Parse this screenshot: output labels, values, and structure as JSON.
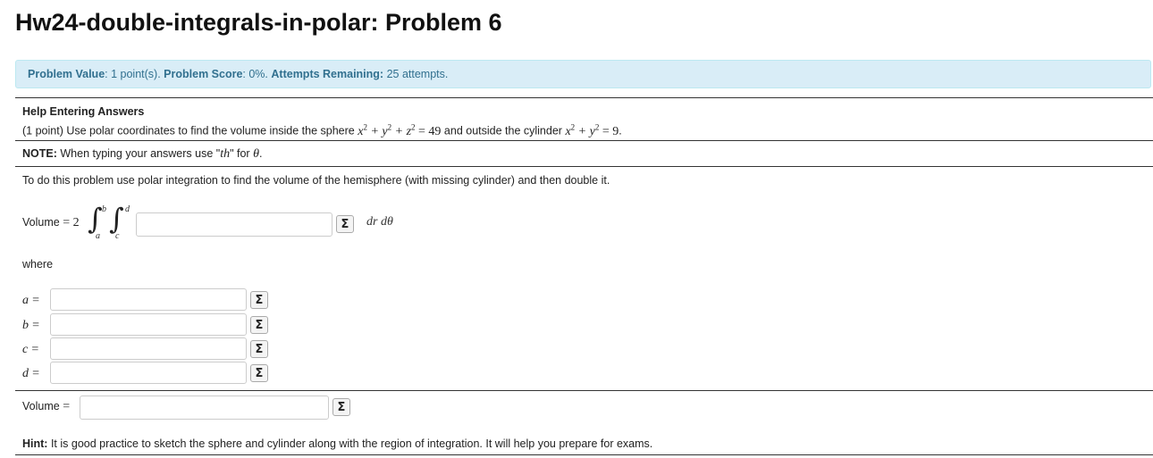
{
  "header": {
    "title": "Hw24-double-integrals-in-polar: Problem 6"
  },
  "info_bar": {
    "value_label": "Problem Value",
    "value_text": ": 1 point(s).",
    "score_label": "Problem Score",
    "score_text": ": 0%.",
    "attempts_label": "Attempts Remaining:",
    "attempts_text": "25 attempts."
  },
  "problem": {
    "help_link": "Help Entering Answers",
    "statement_prefix": "(1 point) Use polar coordinates to find the volume inside the sphere",
    "sphere_eq": "x² + y² + z² = 49",
    "statement_mid": "and outside the cylinder",
    "cylinder_eq": "x² + y² = 9",
    "statement_end": ".",
    "note_label": "NOTE:",
    "note_text": "When typing your answers use \"",
    "note_th": "th",
    "note_mid": "\" for",
    "note_theta": "θ",
    "note_end": ".",
    "instruction": "To do this problem use polar integration to find the volume of the hemisphere (with missing cylinder) and then double it.",
    "volume_label": "Volume",
    "equals": "=",
    "coef": "2",
    "integral_symbol": "∫",
    "lim_b": "b",
    "lim_a": "a",
    "lim_d": "d",
    "lim_c": "c",
    "differentials": "dr dθ",
    "where": "where",
    "hint_label": "Hint:",
    "hint_text": "It is good practice to sketch the sphere and cylinder along with the region of integration. It will help you prepare for exams."
  },
  "answers": {
    "integrand": {
      "value": ""
    },
    "a": {
      "label": "a",
      "value": ""
    },
    "b": {
      "label": "b",
      "value": ""
    },
    "c": {
      "label": "c",
      "value": ""
    },
    "d": {
      "label": "d",
      "value": ""
    },
    "volume": {
      "value": ""
    },
    "equation_editor_icon": "Σ"
  }
}
